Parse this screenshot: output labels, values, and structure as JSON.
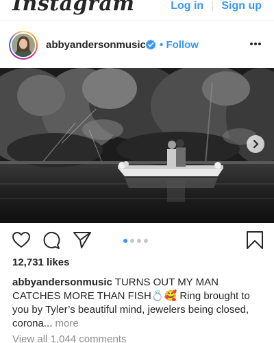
{
  "header": {
    "logo_text": "Instagram",
    "login_label": "Log in",
    "separator": "|",
    "signup_label": "Sign up"
  },
  "post": {
    "username": "abbyandersonmusic",
    "follow_separator": "•",
    "follow_label": "Follow",
    "likes_text": "12,731 likes",
    "caption": {
      "username": "abbyandersonmusic",
      "text": "TURNS OUT MY MAN CATCHES MORE THAN FISH💍🥰 Ring brought to you by Tyler’s beautiful mind, jewelers being closed, corona...",
      "more_label": "more"
    },
    "comments_link": "View all 1,044 comments",
    "carousel": {
      "count": 4,
      "active_index": 0
    }
  },
  "colors": {
    "link_blue": "#3897f0",
    "text": "#262626",
    "muted": "#8e8e8e",
    "verified": "#3897f0"
  },
  "icons": {
    "like": "heart-icon",
    "comment": "comment-icon",
    "share": "share-icon",
    "save": "bookmark-icon",
    "options": "more-options-icon",
    "next": "chevron-right-icon",
    "verified": "verified-badge-icon"
  }
}
